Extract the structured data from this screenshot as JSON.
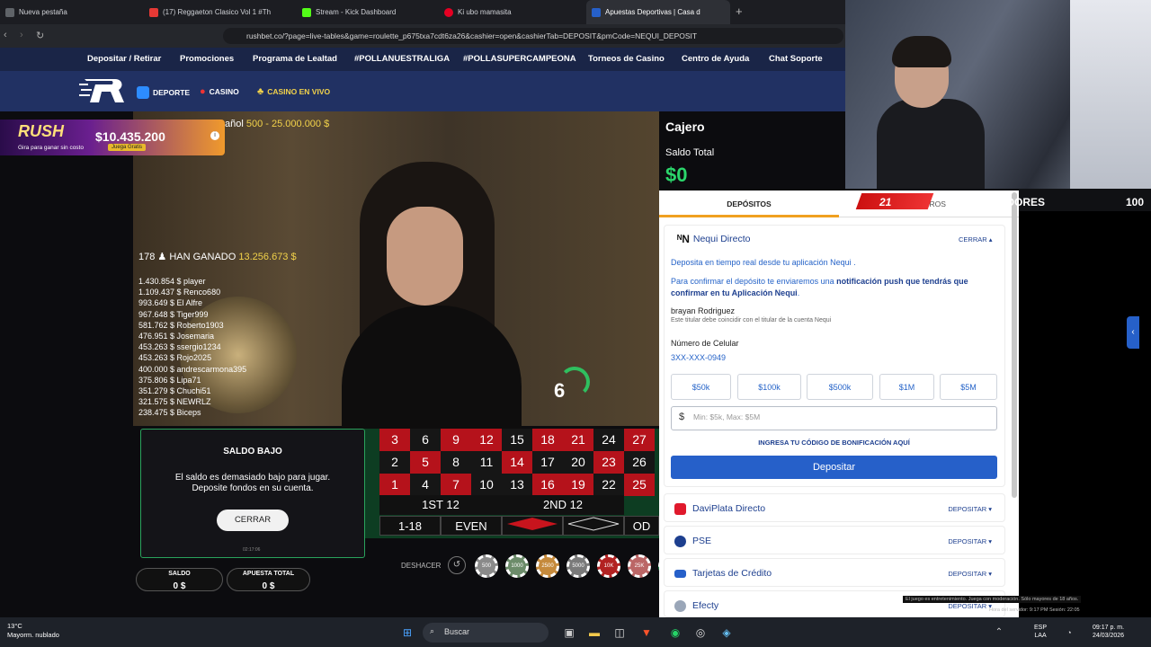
{
  "browser": {
    "tabs": [
      {
        "label": "Nueva pestaña",
        "color": "#5f6368"
      },
      {
        "label": "(17) Reggaeton Clasico Vol 1 #Th",
        "color": "#e53935"
      },
      {
        "label": "Stream - Kick Dashboard",
        "color": "#53fc18"
      },
      {
        "label": "Ki ubo mamasita",
        "color": "#e60023"
      },
      {
        "label": "Apuestas Deportivas | Casa d",
        "color": "#2660c9"
      }
    ],
    "new_tab": "+",
    "url": "rushbet.co/?page=live-tables&game=roulette_p675txa7cdt6za26&cashier=open&cashierTab=DEPOSIT&pmCode=NEQUI_DEPOSIT"
  },
  "site_nav": [
    "Depositar / Retirar",
    "Promociones",
    "Programa de Lealtad",
    "#POLLANUESTRALIGA",
    "#POLLASUPERCAMPEONA",
    "Torneos de Casino",
    "Centro de Ayuda",
    "Chat Soporte"
  ],
  "brand_nav": {
    "deporte": "DEPORTE",
    "casino": "CASINO",
    "casino_vivo": "CASINO EN VIVO"
  },
  "game": {
    "rush_logo": "RUSH",
    "rush_sub": "Gira para ganar sin costo",
    "jackpot": "$10.435.200",
    "juega": "Juega Gratis",
    "limit_label": "añol",
    "limit_range": "500 - 25.000.000 $",
    "winners_count": "178",
    "winners_label": "HAN GANADO",
    "winners_total": "13.256.673 $",
    "winners": [
      "1.430.854 $ player",
      "1.109.437 $ Renco680",
      "993.649 $ El Alfre",
      "967.648 $ Tiger999",
      "581.762 $ Roberto1903",
      "476.951 $ Josemaria",
      "453.263 $ ssergio1234",
      "453.263 $ Rojo2025",
      "400.000 $ andrescarmona395",
      "375.806 $ Lipa71",
      "351.279 $ Chuchi51",
      "321.575 $ NEWRLZ",
      "238.475 $ Biceps"
    ],
    "result": "6",
    "table_rows": [
      [
        {
          "n": "3",
          "c": "red"
        },
        {
          "n": "6",
          "c": "blk"
        },
        {
          "n": "9",
          "c": "red"
        },
        {
          "n": "12",
          "c": "red"
        },
        {
          "n": "15",
          "c": "blk"
        },
        {
          "n": "18",
          "c": "red"
        },
        {
          "n": "21",
          "c": "red"
        },
        {
          "n": "24",
          "c": "blk"
        },
        {
          "n": "27",
          "c": "red"
        }
      ],
      [
        {
          "n": "2",
          "c": "blk"
        },
        {
          "n": "5",
          "c": "red"
        },
        {
          "n": "8",
          "c": "blk"
        },
        {
          "n": "11",
          "c": "blk"
        },
        {
          "n": "14",
          "c": "red"
        },
        {
          "n": "17",
          "c": "blk"
        },
        {
          "n": "20",
          "c": "blk"
        },
        {
          "n": "23",
          "c": "red"
        },
        {
          "n": "26",
          "c": "blk"
        }
      ],
      [
        {
          "n": "1",
          "c": "red"
        },
        {
          "n": "4",
          "c": "blk"
        },
        {
          "n": "7",
          "c": "red"
        },
        {
          "n": "10",
          "c": "blk"
        },
        {
          "n": "13",
          "c": "blk"
        },
        {
          "n": "16",
          "c": "red"
        },
        {
          "n": "19",
          "c": "red"
        },
        {
          "n": "22",
          "c": "blk"
        },
        {
          "n": "25",
          "c": "red"
        }
      ]
    ],
    "dozen1": "1ST 12",
    "dozen2": "2ND 12",
    "low": "1-18",
    "even": "EVEN",
    "odd": "OD",
    "deshacer": "DESHACER",
    "chips": [
      "500",
      "1000",
      "2500",
      "5000",
      "10K",
      "25K",
      "125K"
    ],
    "saldo_label": "SALDO",
    "saldo_value": "0 $",
    "apuesta_label": "APUESTA TOTAL",
    "apuesta_value": "0 $"
  },
  "dialog": {
    "title": "SALDO BAJO",
    "message": "El saldo es demasiado bajo para jugar. Deposite fondos en su cuenta.",
    "button": "CERRAR",
    "clock": "02:17:06"
  },
  "cashier": {
    "title": "Cajero",
    "saldo_label": "Saldo Total",
    "saldo_value": "$0",
    "tab_depositos": "DEPÓSITOS",
    "tab_retiros": "RETIROS",
    "nequi": {
      "name": "Nequi Directo",
      "toggle": "CERRAR",
      "line1": "Deposita en tiempo real desde tu aplicación Nequi .",
      "line2a": "Para confirmar el depósito te enviaremos una ",
      "line2b": "notificación push que tendrás que confirmar en tu Aplicación Nequi",
      "line2c": ".",
      "holder": "brayan Rodriguez",
      "holder_note": "Este titular debe coincidir con el titular de la cuenta Nequi",
      "phone_label": "Número de Celular",
      "phone": "3XX-XXX-0949",
      "amounts": [
        "$50k",
        "$100k",
        "$500k",
        "$1M",
        "$5M"
      ],
      "input_currency": "$",
      "input_placeholder": "Min: $5k, Max: $5M",
      "promo": "INGRESA TU CÓDIGO DE BONIFICACIÓN AQUÍ",
      "deposit_button": "Depositar"
    },
    "methods": [
      {
        "name": "DaviPlata Directo",
        "action": "DEPOSITAR",
        "color": "#e0192c"
      },
      {
        "name": "PSE",
        "action": "DEPOSITAR",
        "color": "#1d3f8f"
      },
      {
        "name": "Tarjetas de Crédito",
        "action": "DEPOSITAR",
        "color": "#2660c9"
      },
      {
        "name": "Efecty",
        "action": "DEPOSITAR",
        "color": "#9aa6b8"
      }
    ]
  },
  "stream": {
    "followers": "21",
    "followers_label": "SEGUIDORES",
    "goal": "100",
    "disclaimer": "El juego es entretenimiento. Juega con moderación. Sólo mayores de 18 años.",
    "server": "Hora del servidor: 9:17 PM   Sesión: 22:05"
  },
  "taskbar": {
    "temp": "13°C",
    "weather": "Mayorm. nublado",
    "search": "Buscar",
    "lang1": "ESP",
    "lang2": "LAA",
    "time": "09:17 p. m.",
    "date": "24/03/2026"
  }
}
